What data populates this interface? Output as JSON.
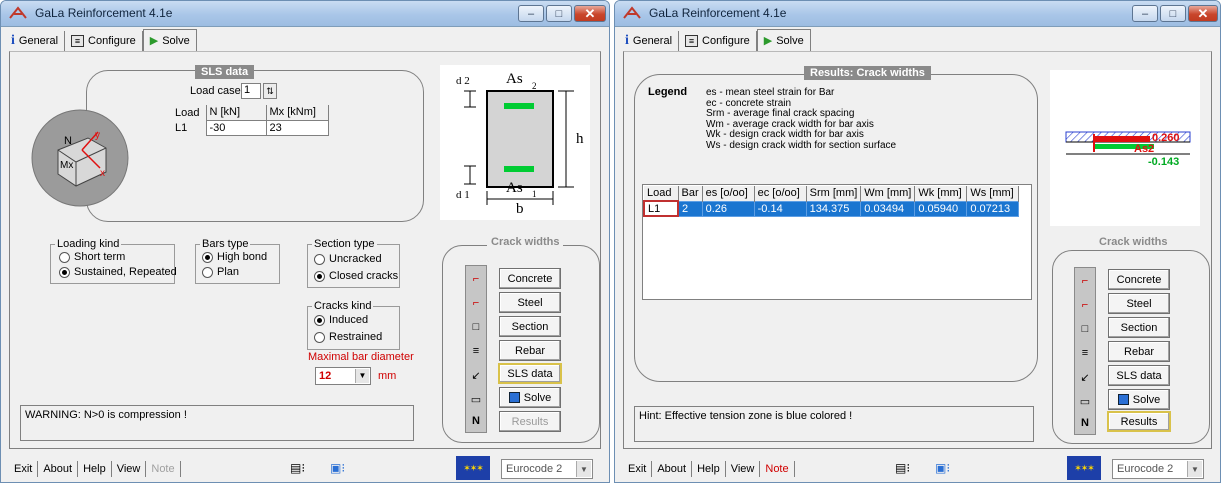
{
  "app": {
    "title": "GaLa Reinforcement  4.1e",
    "tabs": [
      "General",
      "Configure",
      "Solve"
    ]
  },
  "left": {
    "sls": {
      "header": "SLS data",
      "load_cases_label": "Load cases",
      "load_cases_value": "1",
      "columns": [
        "Load",
        "N  [kN]",
        "Mx [kNm]"
      ],
      "rows": [
        [
          "L1",
          "-30",
          "23"
        ]
      ]
    },
    "section_labels": {
      "d2": "d 2",
      "As2": "As",
      "sub2": "2",
      "h": "h",
      "d1": "d 1",
      "As1": "As",
      "sub1": "1",
      "b": "b"
    },
    "loading_kind": {
      "label": "Loading kind",
      "options": [
        "Short term",
        "Sustained, Repeated"
      ],
      "selected": 1
    },
    "bars_type": {
      "label": "Bars type",
      "options": [
        "High bond",
        "Plan"
      ],
      "selected": 0
    },
    "section_type": {
      "label": "Section type",
      "options": [
        "Uncracked",
        "Closed cracks"
      ],
      "selected": 1
    },
    "cracks_kind": {
      "label": "Cracks kind",
      "options": [
        "Induced",
        "Restrained"
      ],
      "selected": 0
    },
    "max_bar": {
      "label": "Maximal bar diameter",
      "value": "12",
      "unit": "mm"
    },
    "warning": "WARNING:  N>0 is compression !"
  },
  "crack_widths": {
    "header": "Crack widths",
    "buttons": [
      "Concrete",
      "Steel",
      "Section",
      "Rebar",
      "SLS data",
      "Solve",
      "Results"
    ]
  },
  "right": {
    "results_header": "Results: Crack widths",
    "legend_title": "Legend",
    "legend": [
      "es  - mean steel strain for Bar",
      "ec  - concrete strain",
      "Srm  - average final crack spacing",
      "Wm  - average crack width for bar axis",
      "Wk  - design crack width for bar axis",
      "Ws  - design crack width for section surface"
    ],
    "columns": [
      "Load",
      "Bar",
      "es [o/oo]",
      "ec [o/oo]",
      "Srm  [mm]",
      "Wm  [mm]",
      "Wk  [mm]",
      "Ws  [mm]"
    ],
    "rows": [
      [
        "L1",
        "2",
        "0.26",
        "-0.14",
        "134.375",
        "0.03494",
        "0.05940",
        "0.07213"
      ]
    ],
    "diagram": {
      "val_top": "0.260",
      "label_as": "As2",
      "val_bottom": "-0.143"
    },
    "hint": "Hint: Effective tension zone is blue colored !"
  },
  "statusbar": {
    "buttons": [
      "Exit",
      "About",
      "Help",
      "View",
      "Note"
    ],
    "eurocode": "Eurocode 2"
  },
  "colors": {
    "accent_red": "#d00000",
    "select_blue": "#1a75d0",
    "rebar_green": "#00cc33"
  }
}
